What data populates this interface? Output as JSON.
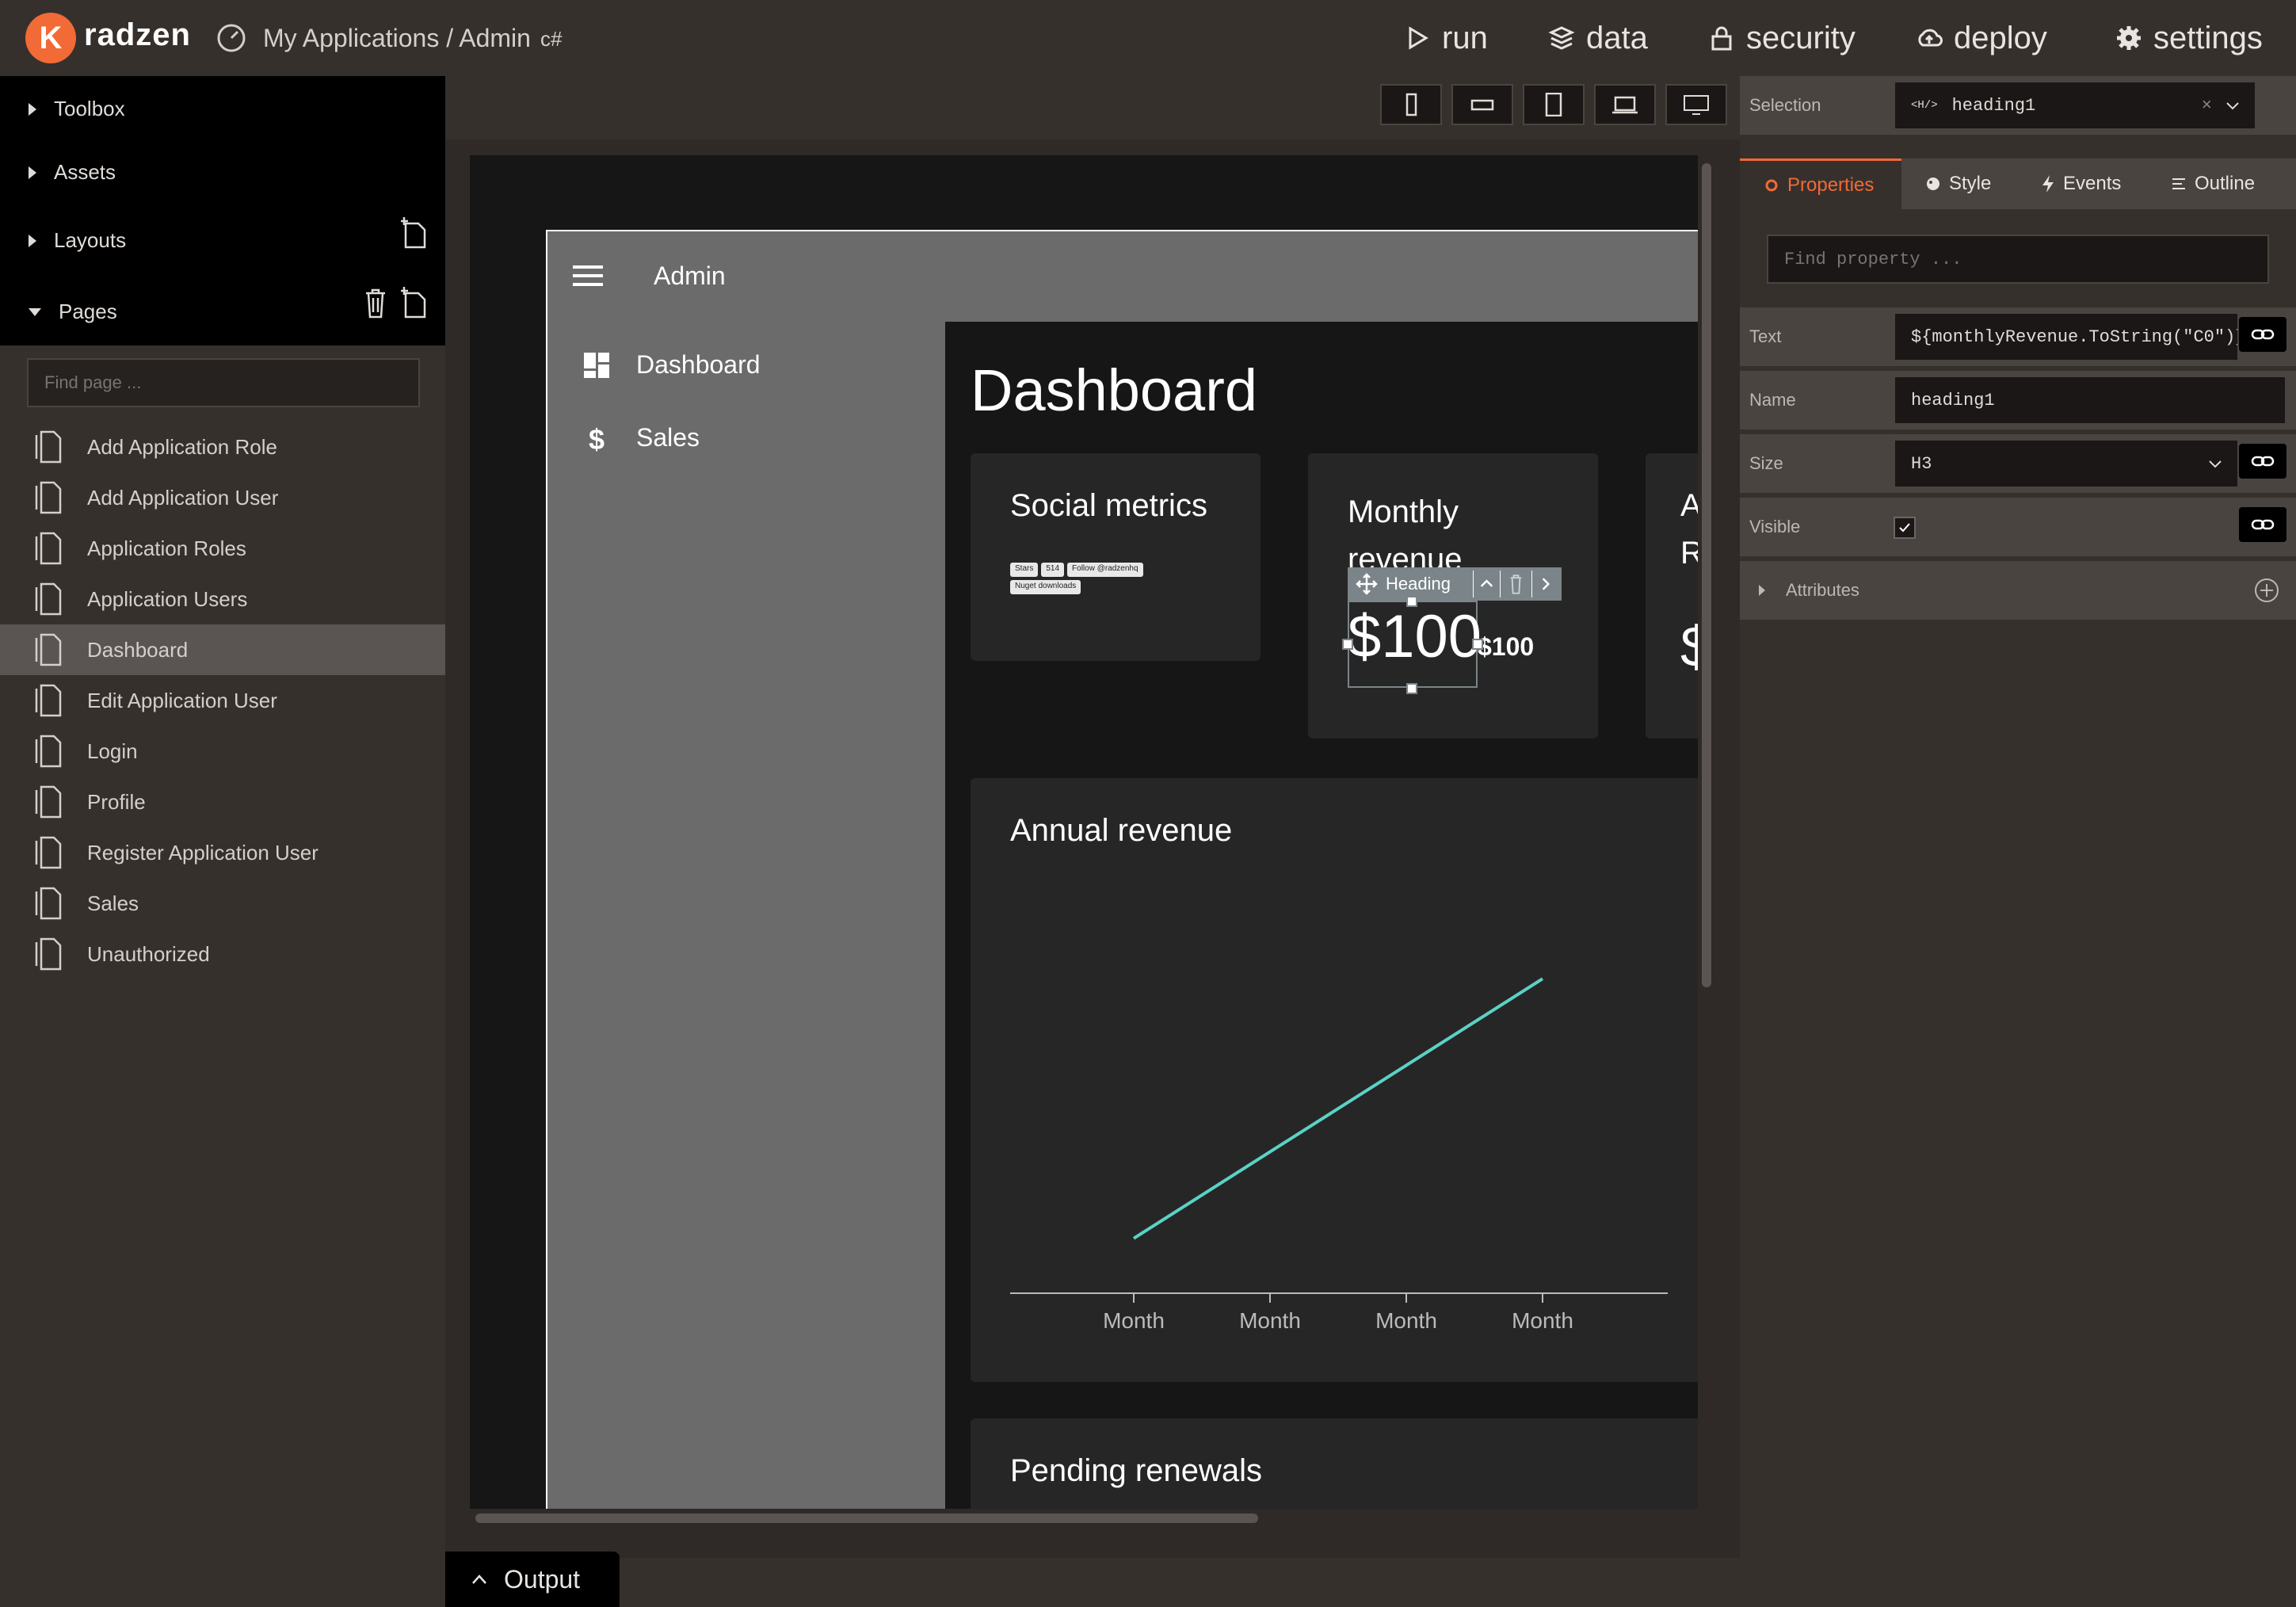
{
  "brand": {
    "name": "radzen",
    "logo_letter": "K"
  },
  "breadcrumb": {
    "text": "My Applications / Admin",
    "lang": "c#"
  },
  "topnav": [
    {
      "label": "run",
      "icon": "play-icon"
    },
    {
      "label": "data",
      "icon": "database-icon"
    },
    {
      "label": "security",
      "icon": "lock-icon"
    },
    {
      "label": "deploy",
      "icon": "cloud-upload-icon"
    },
    {
      "label": "settings",
      "icon": "gear-icon"
    }
  ],
  "left": {
    "sections": [
      "Toolbox",
      "Assets",
      "Layouts",
      "Pages"
    ],
    "find_placeholder": "Find page ...",
    "pages": [
      "Add Application Role",
      "Add Application User",
      "Application Roles",
      "Application Users",
      "Dashboard",
      "Edit Application User",
      "Login",
      "Profile",
      "Register Application User",
      "Sales",
      "Unauthorized"
    ],
    "selected_page": "Dashboard"
  },
  "app": {
    "title": "Admin",
    "nav": [
      "Dashboard",
      "Sales"
    ],
    "page_title": "Dashboard",
    "cards": {
      "social": {
        "title": "Social metrics",
        "badges": [
          "Stars",
          "514",
          "Follow @radzenhq",
          "Nuget downloads"
        ]
      },
      "monthly": {
        "title": "Monthly revenue",
        "value": "$100",
        "value_small": "$100",
        "toolbar_label": "Heading"
      },
      "third": {
        "title_part1": "A",
        "title_part2": "R",
        "value_part": "$"
      },
      "annual": {
        "title": "Annual revenue"
      },
      "pending": {
        "title": "Pending renewals"
      }
    }
  },
  "chart_data": {
    "type": "line",
    "title": "Annual revenue",
    "categories": [
      "Month",
      "Month",
      "Month",
      "Month"
    ],
    "series": [
      {
        "values": [
          100,
          200,
          300,
          400
        ],
        "color": "#5bd1c6"
      }
    ],
    "legend_colors": [
      "#1e78c8",
      "#5bd1c6"
    ],
    "xlabel": "",
    "ylabel": ""
  },
  "right": {
    "selection_label": "Selection",
    "selection_value": "heading1",
    "tabs": [
      "Properties",
      "Style",
      "Events",
      "Outline"
    ],
    "find_placeholder": "Find property ...",
    "props": [
      {
        "label": "Text",
        "value": "${monthlyRevenue.ToString(\"C0\")}"
      },
      {
        "label": "Name",
        "value": "heading1"
      },
      {
        "label": "Size",
        "value": "H3"
      },
      {
        "label": "Visible",
        "value": ""
      }
    ],
    "attributes_label": "Attributes"
  },
  "output": {
    "label": "Output"
  }
}
